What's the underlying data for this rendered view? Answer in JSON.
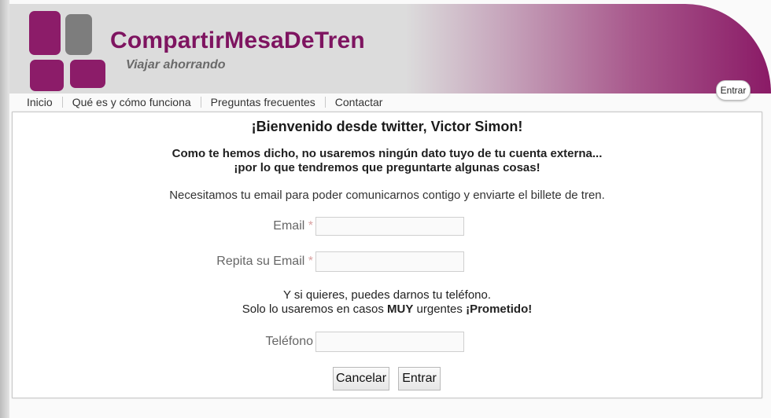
{
  "header": {
    "brand": "CompartirMesaDeTren",
    "tagline": "Viajar ahorrando",
    "login_button": "Entrar"
  },
  "nav": {
    "items": [
      {
        "label": "Inicio"
      },
      {
        "label": "Qué es y cómo funciona"
      },
      {
        "label": "Preguntas frecuentes"
      },
      {
        "label": "Contactar"
      }
    ]
  },
  "main": {
    "welcome": "¡Bienvenido desde twitter, Victor Simon!",
    "notice_line1": "Como te hemos dicho, no usaremos ningún dato tuyo de tu cuenta externa...",
    "notice_line2": "¡por lo que tendremos que preguntarte algunas cosas!",
    "email_need": "Necesitamos tu email para poder comunicarnos contigo y enviarte el billete de tren.",
    "fields": {
      "email_label": "Email",
      "email_required": "*",
      "email_value": "",
      "repeat_email_label": "Repita su Email",
      "repeat_email_required": "*",
      "repeat_email_value": "",
      "phone_label": "Teléfono",
      "phone_value": ""
    },
    "phone_note_line1": "Y si quieres, puedes darnos tu teléfono.",
    "phone_note_part1": "Solo lo usaremos en casos ",
    "phone_note_bold1": "MUY",
    "phone_note_part2": " urgentes ",
    "phone_note_bold2": "¡Prometido!",
    "buttons": {
      "cancel": "Cancelar",
      "submit": "Entrar"
    }
  },
  "colors": {
    "brand": "#7e1460",
    "logo_gray": "#7d7d7d",
    "header_gray": "#dcdcdc"
  }
}
